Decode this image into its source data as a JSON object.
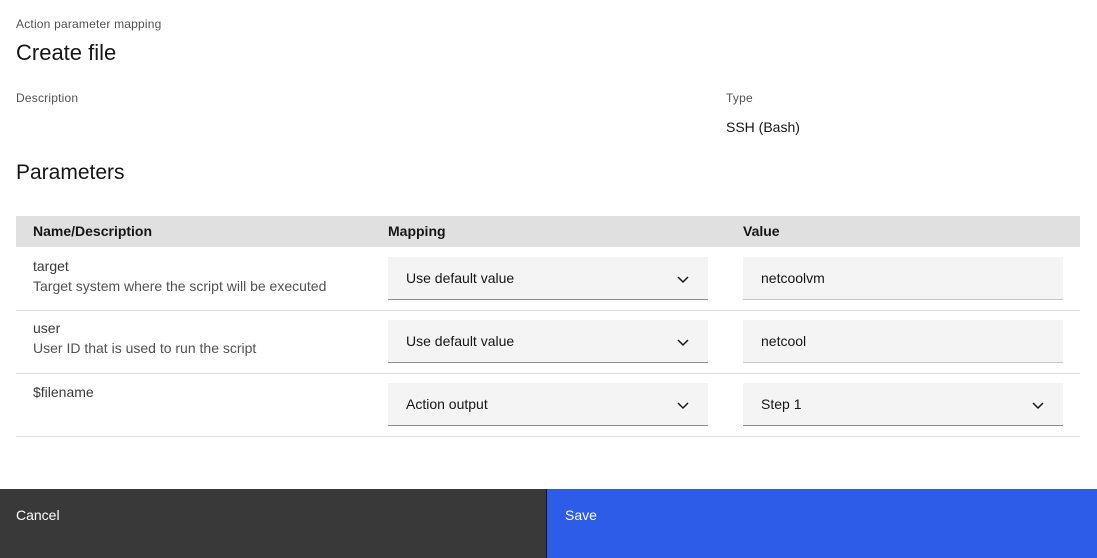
{
  "header": {
    "eyebrow": "Action parameter mapping",
    "title": "Create file"
  },
  "details": {
    "description_label": "Description",
    "type_label": "Type",
    "type_value": "SSH (Bash)"
  },
  "parameters": {
    "section_title": "Parameters",
    "columns": [
      "Name/Description",
      "Mapping",
      "Value"
    ],
    "rows": [
      {
        "name": "target",
        "description": "Target system where the script will be executed",
        "mapping": "Use default value",
        "value": "netcoolvm"
      },
      {
        "name": "user",
        "description": "User ID that is used to run the script",
        "mapping": "Use default value",
        "value": "netcool"
      },
      {
        "name": "$filename",
        "description": "",
        "mapping": "Action output",
        "value": "Step 1"
      }
    ]
  },
  "footer": {
    "cancel_label": "Cancel",
    "save_label": "Save"
  },
  "colors": {
    "primary": "#2d5ce8",
    "secondary": "#393939",
    "table_header": "#e0e0e0",
    "field_bg": "#f4f4f4"
  },
  "icons": {
    "dropdown": "chevron-down-icon"
  }
}
